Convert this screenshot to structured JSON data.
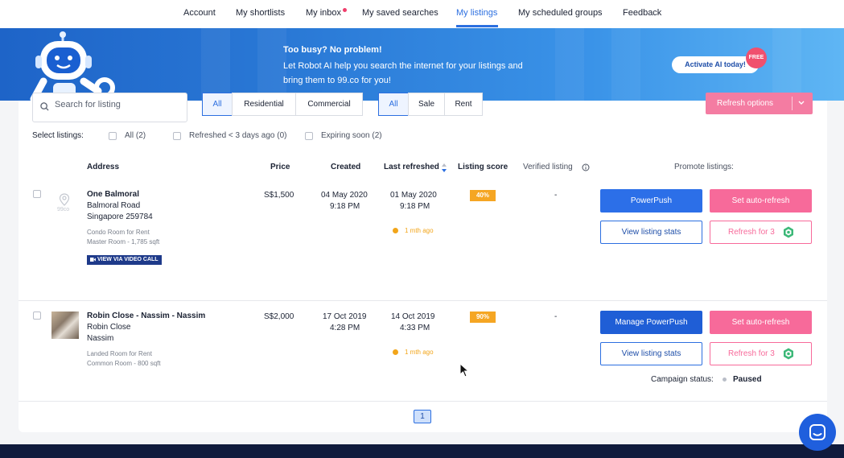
{
  "nav": {
    "items": [
      "Account",
      "My shortlists",
      "My inbox",
      "My saved searches",
      "My listings",
      "My scheduled groups",
      "Feedback"
    ],
    "active": "My listings"
  },
  "banner": {
    "title": "Too busy? No problem!",
    "text": "Let Robot AI help you search the internet for your listings and bring them to 99.co for you!",
    "cta": "Activate AI today!",
    "badge": "FREE"
  },
  "filters": {
    "search_placeholder": "Search for listing",
    "type": [
      "All",
      "Residential",
      "Commercial"
    ],
    "mode": [
      "All",
      "Sale",
      "Rent"
    ],
    "refresh_options": "Refresh options"
  },
  "select": {
    "label": "Select listings:",
    "options": [
      "All (2)",
      "Refreshed < 3 days ago (0)",
      "Expiring soon (2)"
    ]
  },
  "columns": {
    "address": "Address",
    "price": "Price",
    "created": "Created",
    "last_refreshed": "Last refreshed",
    "listing_score": "Listing score",
    "verified": "Verified listing",
    "promote": "Promote listings:"
  },
  "listings": [
    {
      "title": "One Balmoral",
      "line1": "Balmoral Road",
      "line2": "Singapore 259784",
      "meta1": "Condo Room for Rent",
      "meta2": "Master Room - 1,785 sqft",
      "badge": "VIEW VIA VIDEO CALL",
      "placeholder_logo": "99co",
      "price": "S$1,500",
      "created_date": "04 May 2020",
      "created_time": "9:18 PM",
      "refreshed_date": "01 May 2020",
      "refreshed_time": "9:18 PM",
      "ago": "1 mth ago",
      "score": "40%",
      "verified": "-",
      "btn_push": "PowerPush",
      "btn_auto": "Set auto-refresh",
      "btn_stats": "View listing stats",
      "btn_refresh": "Refresh for 3"
    },
    {
      "title": "Robin Close - Nassim - Nassim",
      "line1": "Robin Close",
      "line2": "Nassim",
      "meta1": "Landed Room for Rent",
      "meta2": "Common Room - 800 sqft",
      "price": "S$2,000",
      "created_date": "17 Oct 2019",
      "created_time": "4:28 PM",
      "refreshed_date": "14 Oct 2019",
      "refreshed_time": "4:33 PM",
      "ago": "1 mth ago",
      "score": "90%",
      "verified": "-",
      "btn_push": "Manage PowerPush",
      "btn_auto": "Set auto-refresh",
      "btn_stats": "View listing stats",
      "btn_refresh": "Refresh for 3",
      "campaign_label": "Campaign status:",
      "campaign_value": "Paused"
    }
  ],
  "pagination": {
    "current": "1"
  },
  "colors": {
    "accent": "#2c6fe0",
    "pink": "#f76a9a",
    "score": "#f5a623",
    "footer": "#101b3d"
  },
  "icons": {
    "search": "search-icon",
    "sort": "sort-icon",
    "info": "info-icon",
    "location": "location-pin-icon",
    "video": "video-icon",
    "coin": "hex-coin-icon",
    "chat": "chat-icon",
    "robot": "robot-mascot-icon"
  }
}
